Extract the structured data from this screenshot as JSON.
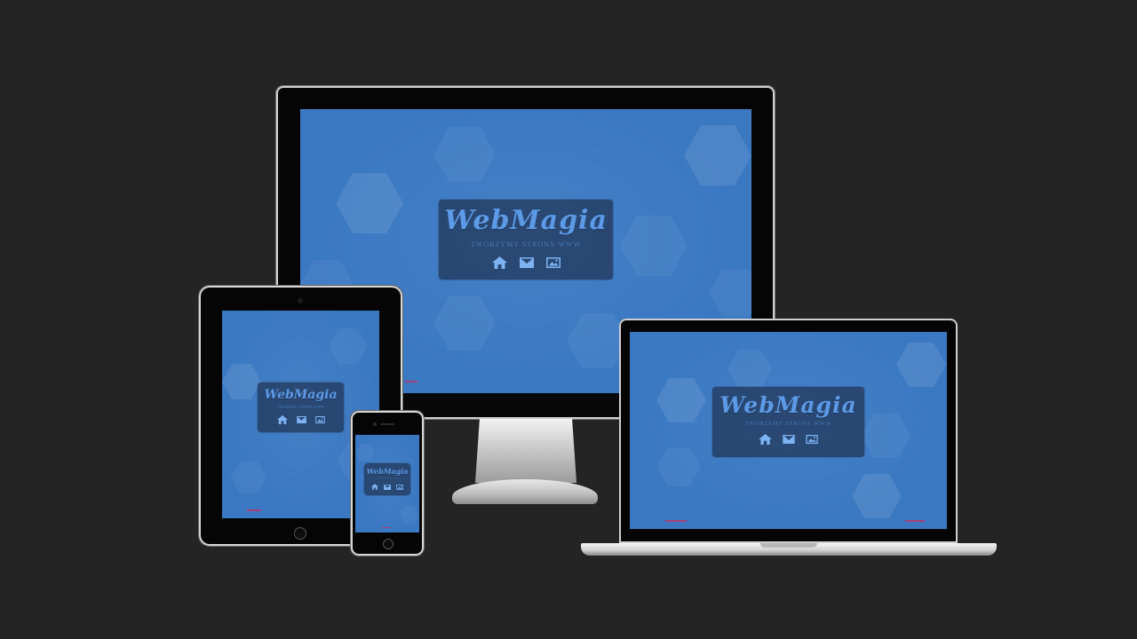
{
  "site": {
    "logo": "WebMagia",
    "tagline": "TWORZYMY STRONY WWW",
    "nav_icons": [
      "home-icon",
      "envelope-icon",
      "image-icon"
    ]
  },
  "colors": {
    "background": "#242424",
    "screen": "#3a78c2",
    "card": "#22385c",
    "logo": "#5c9ae6",
    "icon": "#7db3f2"
  }
}
